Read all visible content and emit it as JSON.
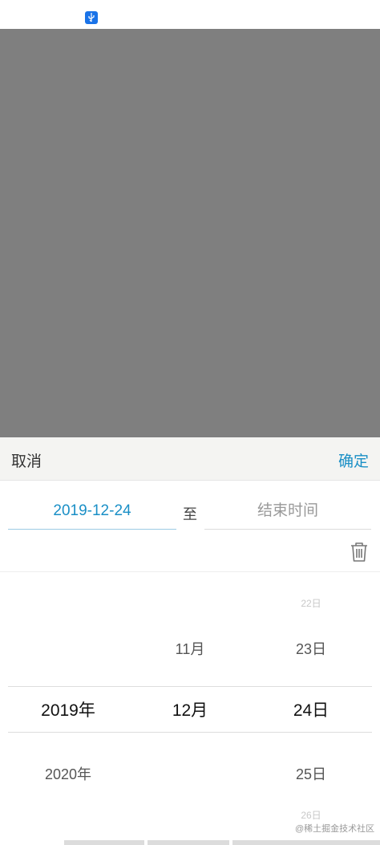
{
  "status_bar": {
    "icon": "usb-icon"
  },
  "sheet": {
    "cancel_label": "取消",
    "confirm_label": "确定",
    "accent_color": "#1a8fc6",
    "range": {
      "start_value": "2019-12-24",
      "separator": "至",
      "end_placeholder": "结束时间"
    },
    "clear_icon": "trash-icon"
  },
  "picker": {
    "year": {
      "selected": "2019年",
      "after": "2020年"
    },
    "month": {
      "before": "11月",
      "selected": "12月"
    },
    "day": {
      "far_before": "22日",
      "before": "23日",
      "selected": "24日",
      "after": "25日",
      "far_after": "26日"
    }
  },
  "watermark": "@稀土掘金技术社区"
}
